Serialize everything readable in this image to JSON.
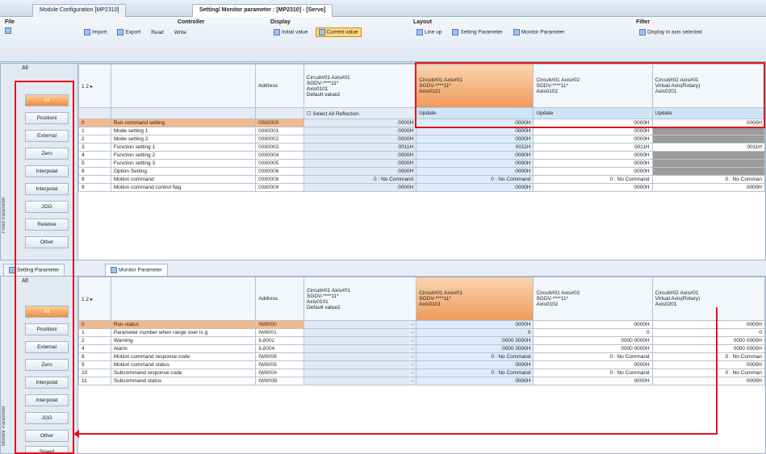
{
  "tabs": [
    {
      "label": "Module Configuration [MP2310]"
    },
    {
      "label": "Setting/ Monitor parameter : [MP2310] - [Servo]"
    }
  ],
  "ribbon": {
    "file": {
      "title": "File"
    },
    "controller": {
      "title": "Controller",
      "import": "Import",
      "export": "Export",
      "read": "Read",
      "write": "Write"
    },
    "display": {
      "title": "Display",
      "initial": "Initial value",
      "current": "Current value"
    },
    "layout": {
      "title": "Layout",
      "lineup": "Line up",
      "setting": "Setting Parameter",
      "monitor": "Monitor Parameter"
    },
    "filter": {
      "title": "Filter",
      "axis": "Display in axis selected"
    }
  },
  "sidebar": {
    "all": "All",
    "labels": [
      "All",
      "Positioni",
      "External",
      "Zero",
      "Interpolat",
      "Interpolat",
      "JOG",
      "Relative",
      "Other"
    ],
    "vertical": "Fixed Parameter"
  },
  "sidebar2": {
    "all": "All",
    "labels": [
      "All",
      "Positioni",
      "External",
      "Zero",
      "Interpolat",
      "Interpolat",
      "JOG",
      "Other",
      "Speed"
    ],
    "vertical": "Monitor Parameter"
  },
  "grid_top": {
    "pager": "1 2 ▸",
    "address": "Address",
    "axes": [
      {
        "name": "Circuit#01 Axis#01",
        "sub": "SGDV-****11*",
        "sub2": "Axis0101"
      },
      {
        "name": "Circuit#01 Axis#02",
        "sub": "SGDV-****11*",
        "sub2": "Axis0102"
      },
      {
        "name": "Circuit#02 Axis#01",
        "sub": "Virtual Axis(Rotary)",
        "sub2": "Axis0201"
      }
    ],
    "ref": {
      "name": "Circuit#01 Axis#01",
      "sub": "SGDV-****11*",
      "sub2": "Axis0101",
      "sub3": "Default value2"
    },
    "select_all": "Select All",
    "reflection": "Reflection",
    "update": "Update",
    "rows": [
      {
        "no": "0",
        "name": "Run command setting",
        "addr": "0080000",
        "ref": "0000H",
        "v1": "0000H",
        "v2": "0000H",
        "v3": "0000H",
        "sel": true
      },
      {
        "no": "1",
        "name": "Mode setting 1",
        "addr": "0080001",
        "ref": "0000H",
        "v1": "0000H",
        "v2": "0000H",
        "v3": "",
        "g3": true
      },
      {
        "no": "2",
        "name": "Mode setting 2",
        "addr": "0080002",
        "ref": "0000H",
        "v1": "0000H",
        "v2": "0000H",
        "v3": "",
        "g3": true
      },
      {
        "no": "3",
        "name": "Function setting 1",
        "addr": "0080003",
        "ref": "0011H",
        "v1": "0011H",
        "v2": "0011H",
        "v3": "0011H"
      },
      {
        "no": "4",
        "name": "Function setting 2",
        "addr": "0080004",
        "ref": "0000H",
        "v1": "0000H",
        "v2": "0000H",
        "v3": "",
        "g3": true
      },
      {
        "no": "5",
        "name": "Function setting 3",
        "addr": "0080005",
        "ref": "0000H",
        "v1": "0000H",
        "v2": "0000H",
        "v3": "",
        "g3": true
      },
      {
        "no": "6",
        "name": "Option Setting",
        "addr": "0080006",
        "ref": "0000H",
        "v1": "0000H",
        "v2": "0000H",
        "v3": "",
        "g3": true
      },
      {
        "no": "8",
        "name": "Motion command",
        "addr": "0080008",
        "ref": "0 : No Command",
        "v1": "0 : No Command",
        "v2": "0 : No Command",
        "v3": "0 : No Comman"
      },
      {
        "no": "9",
        "name": "Motion command control flag",
        "addr": "0080009",
        "ref": "0000H",
        "v1": "0000H",
        "v2": "0000H",
        "v3": "0000H"
      }
    ]
  },
  "bottom_tabs": {
    "setting": "Setting Parameter",
    "monitor": "Monitor Parameter"
  },
  "grid_bottom": {
    "pager": "1 2 ▸",
    "address": "Address",
    "rows": [
      {
        "no": "0",
        "name": "Run status",
        "addr": "IW8000",
        "ref": "-",
        "v1": "0000H",
        "v2": "0000H",
        "v3": "0000H",
        "sel": true
      },
      {
        "no": "1",
        "name": "Parameter number when range over is g",
        "addr": "IW8001",
        "ref": "-",
        "v1": "0",
        "v2": "0",
        "v3": "0"
      },
      {
        "no": "2",
        "name": "Warning",
        "addr": "IL8002",
        "ref": "-",
        "v1": "0000 0000H",
        "v2": "0000 0000H",
        "v3": "0000 0000H"
      },
      {
        "no": "4",
        "name": "Alarm",
        "addr": "IL8004",
        "ref": "-",
        "v1": "0000 0000H",
        "v2": "0000 0000H",
        "v3": "0000 0000H"
      },
      {
        "no": "8",
        "name": "Motion command response code",
        "addr": "IW8008",
        "ref": "-",
        "v1": "0 : No Command",
        "v2": "0 : No Command",
        "v3": "0 : No Comman"
      },
      {
        "no": "9",
        "name": "Motion command status",
        "addr": "IW8009",
        "ref": "-",
        "v1": "0000H",
        "v2": "0000H",
        "v3": "0000H"
      },
      {
        "no": "10",
        "name": "Subcommand response code",
        "addr": "IW800A",
        "ref": "-",
        "v1": "0 : No Command",
        "v2": "0 : No Command",
        "v3": "0 : No Comman"
      },
      {
        "no": "11",
        "name": "Subcommand status",
        "addr": "IW800B",
        "ref": "-",
        "v1": "0000H",
        "v2": "0000H",
        "v3": "0000H"
      }
    ]
  }
}
